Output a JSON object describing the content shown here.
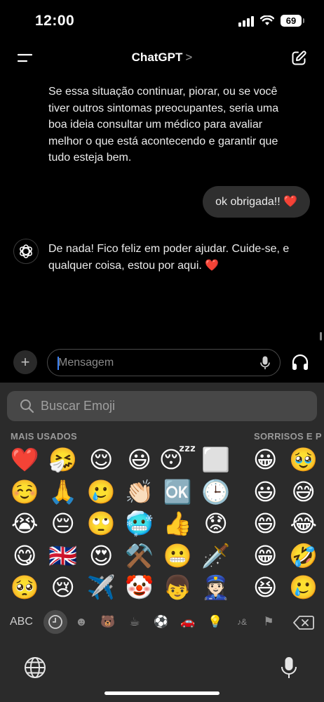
{
  "status_bar": {
    "time": "12:00",
    "battery": "69",
    "icons": [
      "signal-icon",
      "wifi-icon",
      "battery-icon"
    ]
  },
  "nav": {
    "title": "ChatGPT",
    "title_chevron": ">",
    "menu_icon": "menu-icon",
    "edit_icon": "new-chat-icon"
  },
  "chat": {
    "assistant_message_1": "Se essa situação continuar, piorar, ou se você tiver outros sintomas preocupantes, seria uma boa ideia consultar um médico para avaliar melhor o que está acontecendo e garantir que tudo esteja bem.",
    "user_message": "ok obrigada!! ❤️",
    "assistant_message_2": "De nada! Fico feliz em poder ajudar. Cuide-se, e qualquer coisa, estou por aqui. ❤️"
  },
  "composer": {
    "plus": "+",
    "placeholder": "Mensagem",
    "mic_icon": "microphone-icon",
    "voice_icon": "headphones-icon"
  },
  "keyboard": {
    "search_placeholder": "Buscar Emoji",
    "section_frequent": "MAIS USADOS",
    "section_smileys": "SORRISOS E P",
    "frequent": [
      "❤️",
      "🤧",
      "😌",
      "😃",
      "😴",
      "⬜",
      "☺️",
      "🙏",
      "🥲",
      "👏🏻",
      "🆗",
      "🕒",
      "😭",
      "😔",
      "🙄",
      "🥶",
      "👍",
      "😟",
      "😋",
      "🇬🇧",
      "😍",
      "⚒️",
      "😬",
      "🗡️",
      "🥺",
      "😢",
      "✈️",
      "🤡",
      "👦",
      "👮🏻‍♀️"
    ],
    "smileys": [
      "😀",
      "🥹",
      "😃",
      "😅",
      "😄",
      "😂",
      "😁",
      "🤣",
      "😆",
      "🥲"
    ],
    "abc_label": "ABC",
    "categories": [
      "recent-icon",
      "smiley-icon",
      "animal-icon",
      "food-icon",
      "ball-icon",
      "car-icon",
      "bulb-icon",
      "symbols-icon",
      "flag-icon"
    ],
    "backspace_icon": "backspace-icon",
    "globe_icon": "globe-icon",
    "dictation_icon": "microphone-icon"
  }
}
